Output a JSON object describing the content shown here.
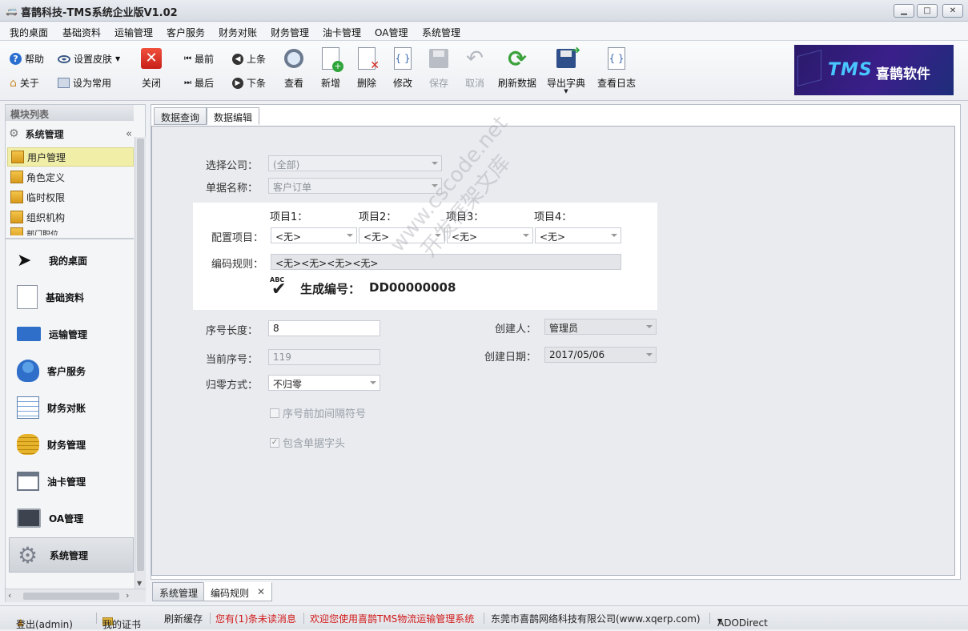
{
  "window": {
    "title": "喜鹊科技-TMS系统企业版V1.02",
    "min": "▁",
    "max": "□",
    "close": "✕"
  },
  "menu": [
    "我的桌面",
    "基础资料",
    "运输管理",
    "客户服务",
    "财务对账",
    "财务管理",
    "油卡管理",
    "OA管理",
    "系统管理"
  ],
  "toolbar": {
    "help": "帮助",
    "skin": "设置皮肤",
    "about": "关于",
    "favorite": "设为常用",
    "close": "关闭",
    "first": "最前",
    "prev": "上条",
    "last": "最后",
    "next": "下条",
    "view": "查看",
    "add": "新增",
    "delete": "删除",
    "edit": "修改",
    "save": "保存",
    "cancel": "取消",
    "refresh": "刷新数据",
    "export": "导出字典",
    "log": "查看日志"
  },
  "logo": {
    "tms": "TMS",
    "name": "喜鹊软件"
  },
  "sidebar": {
    "header": "模块列表",
    "group": "系统管理",
    "collapse": "«",
    "items": [
      "用户管理",
      "角色定义",
      "临时权限",
      "组织机构",
      "部门职位"
    ],
    "modules": [
      "我的桌面",
      "基础资料",
      "运输管理",
      "客户服务",
      "财务对账",
      "财务管理",
      "油卡管理",
      "OA管理",
      "系统管理"
    ]
  },
  "tabs": {
    "query": "数据查询",
    "edit": "数据编辑"
  },
  "form": {
    "company_label": "选择公司：",
    "company_value": "(全部)",
    "doc_label": "单据名称：",
    "doc_value": "客户订单",
    "item1": "项目1：",
    "item2": "项目2：",
    "item3": "项目3：",
    "item4": "项目4：",
    "config_label": "配置项目：",
    "item_values": [
      "<无>",
      "<无>",
      "<无>",
      "<无>"
    ],
    "rule_label": "编码规则：",
    "rule_value": "<无><无><无><无>",
    "abc": "ABC",
    "gen_label": "生成编号：",
    "gen_value": "DD00000008",
    "seqlen_label": "序号长度：",
    "seqlen_value": "8",
    "curseq_label": "当前序号：",
    "curseq_value": "119",
    "reset_label": "归零方式：",
    "reset_value": "不归零",
    "creator_label": "创建人：",
    "creator_value": "管理员",
    "date_label": "创建日期：",
    "date_value": "2017/05/06",
    "sep_check": "序号前加间隔符号",
    "head_check": "包含单据字头"
  },
  "watermark": {
    "line1": "www.cscode.net",
    "line2": "开发框架文库"
  },
  "bottom_tabs": {
    "sys": "系统管理",
    "rule": "编码规则",
    "close": "✕"
  },
  "status": {
    "logout": "登出(admin)",
    "cert": "我的证书",
    "refresh": "刷新缓存",
    "unread": "您有(1)条未读消息",
    "welcome": "欢迎您使用喜鹊TMS物流运输管理系统",
    "company": "东莞市喜鹊网络科技有限公司(www.xqerp.com)",
    "db": "ADODirect"
  }
}
